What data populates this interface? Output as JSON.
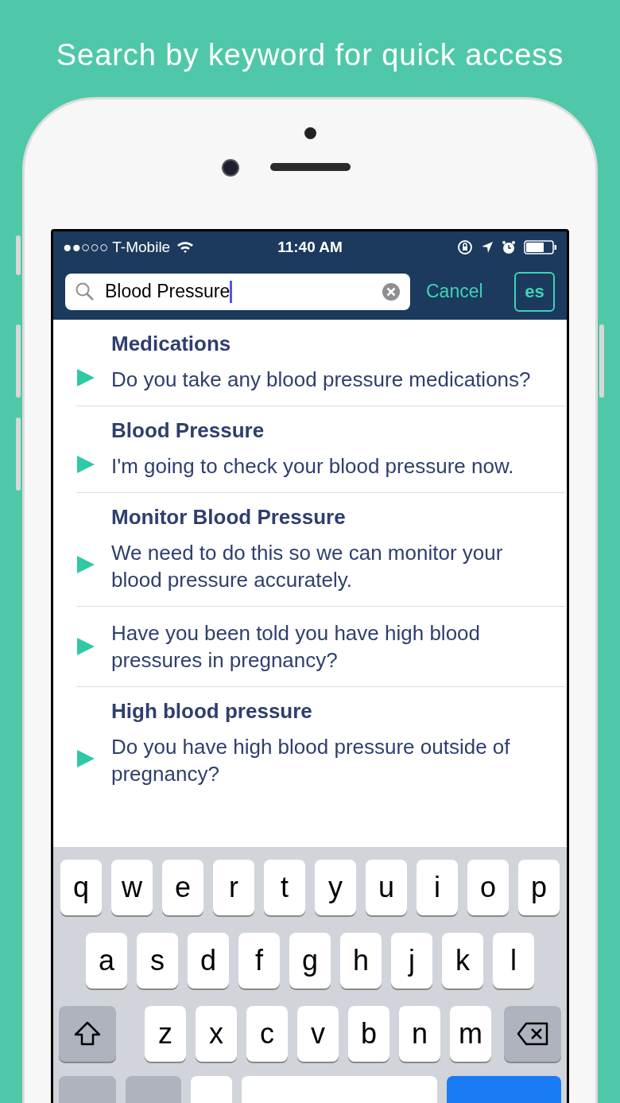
{
  "headline": "Search by keyword for quick access",
  "status_bar": {
    "carrier": "●●○○○ T-Mobile",
    "time": "11:40 AM"
  },
  "search": {
    "value": "Blood Pressure",
    "cancel": "Cancel",
    "language": "es"
  },
  "results": [
    {
      "title": "Medications",
      "text": "Do you take any blood pressure medications?"
    },
    {
      "title": "Blood Pressure",
      "text": "I'm going to check your blood pressure now."
    },
    {
      "title": "Monitor Blood Pressure",
      "text": "We need to do this so we can monitor your blood pressure accurately."
    },
    {
      "text": "Have you been told you have high blood pressures in pregnancy?"
    },
    {
      "title": "High blood pressure",
      "text": "Do you have high blood pressure outside of pregnancy?"
    }
  ],
  "keyboard": {
    "rows": [
      [
        "q",
        "w",
        "e",
        "r",
        "t",
        "y",
        "u",
        "i",
        "o",
        "p"
      ],
      [
        "a",
        "s",
        "d",
        "f",
        "g",
        "h",
        "j",
        "k",
        "l"
      ],
      [
        "z",
        "x",
        "c",
        "v",
        "b",
        "n",
        "m"
      ]
    ]
  }
}
